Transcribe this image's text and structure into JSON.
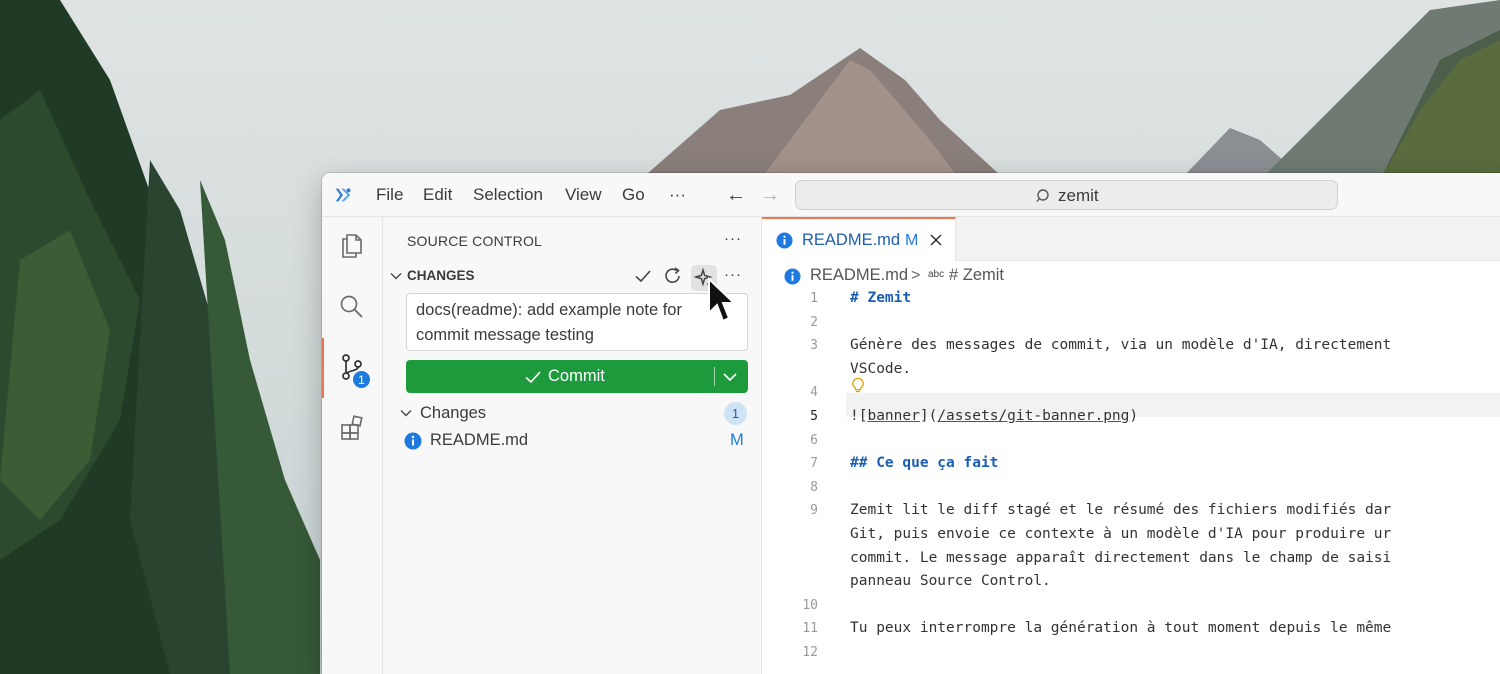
{
  "menu": [
    "File",
    "Edit",
    "Selection",
    "View",
    "Go",
    "···"
  ],
  "command_center": {
    "text": "zemit"
  },
  "activity_bar": {
    "scm_badge": "1"
  },
  "sidebar": {
    "title": "SOURCE CONTROL",
    "more": "···",
    "section": {
      "title": "CHANGES",
      "more": "···"
    },
    "commit_message": "docs(readme): add example note for commit message testing",
    "commit_button": "Commit",
    "changes_group": {
      "label": "Changes",
      "count": "1",
      "files": [
        {
          "name": "README.md",
          "status": "M"
        }
      ]
    }
  },
  "editor": {
    "tab": {
      "name": "README.md",
      "status": "M"
    },
    "breadcrumb": {
      "file": "README.md",
      "separator": ">",
      "symbol_kind": "abc",
      "symbol": "# Zemit"
    },
    "lines": [
      {
        "num": "1",
        "text": "# Zemit",
        "kind": "heading"
      },
      {
        "num": "2",
        "text": "",
        "kind": "text"
      },
      {
        "num": "3",
        "text": "Génère des messages de commit, via un modèle d'IA, directement",
        "kind": "text"
      },
      {
        "num": "",
        "text": "VSCode.",
        "kind": "text"
      },
      {
        "num": "4",
        "text": "",
        "kind": "text"
      },
      {
        "num": "5",
        "text": "![banner](/assets/git-banner.png)",
        "kind": "link"
      },
      {
        "num": "6",
        "text": "",
        "kind": "text"
      },
      {
        "num": "7",
        "text": "## Ce que ça fait",
        "kind": "heading"
      },
      {
        "num": "8",
        "text": "",
        "kind": "text"
      },
      {
        "num": "9",
        "text": "Zemit lit le diff stagé et le résumé des fichiers modifiés dar",
        "kind": "text"
      },
      {
        "num": "",
        "text": "Git, puis envoie ce contexte à un modèle d'IA pour produire ur",
        "kind": "text"
      },
      {
        "num": "",
        "text": "commit. Le message apparaît directement dans le champ de saisi",
        "kind": "text"
      },
      {
        "num": "",
        "text": "panneau Source Control.",
        "kind": "text"
      },
      {
        "num": "10",
        "text": "",
        "kind": "text"
      },
      {
        "num": "11",
        "text": "Tu peux interrompre la génération à tout moment depuis le même",
        "kind": "text"
      },
      {
        "num": "12",
        "text": "",
        "kind": "text"
      }
    ],
    "active_line": "5"
  },
  "colors": {
    "accent": "#f0754e",
    "commit_green": "#1d9b3c",
    "info_blue": "#1f7ae0",
    "heading_blue": "#1a5fb4"
  },
  "icons": [
    "app-logo-icon",
    "search-icon",
    "back-arrow-icon",
    "forward-arrow-icon",
    "explorer-icon",
    "source-control-icon",
    "extensions-icon",
    "check-icon",
    "refresh-icon",
    "sparkle-icon",
    "chevron-down-icon",
    "info-icon",
    "close-icon",
    "lightbulb-icon"
  ]
}
